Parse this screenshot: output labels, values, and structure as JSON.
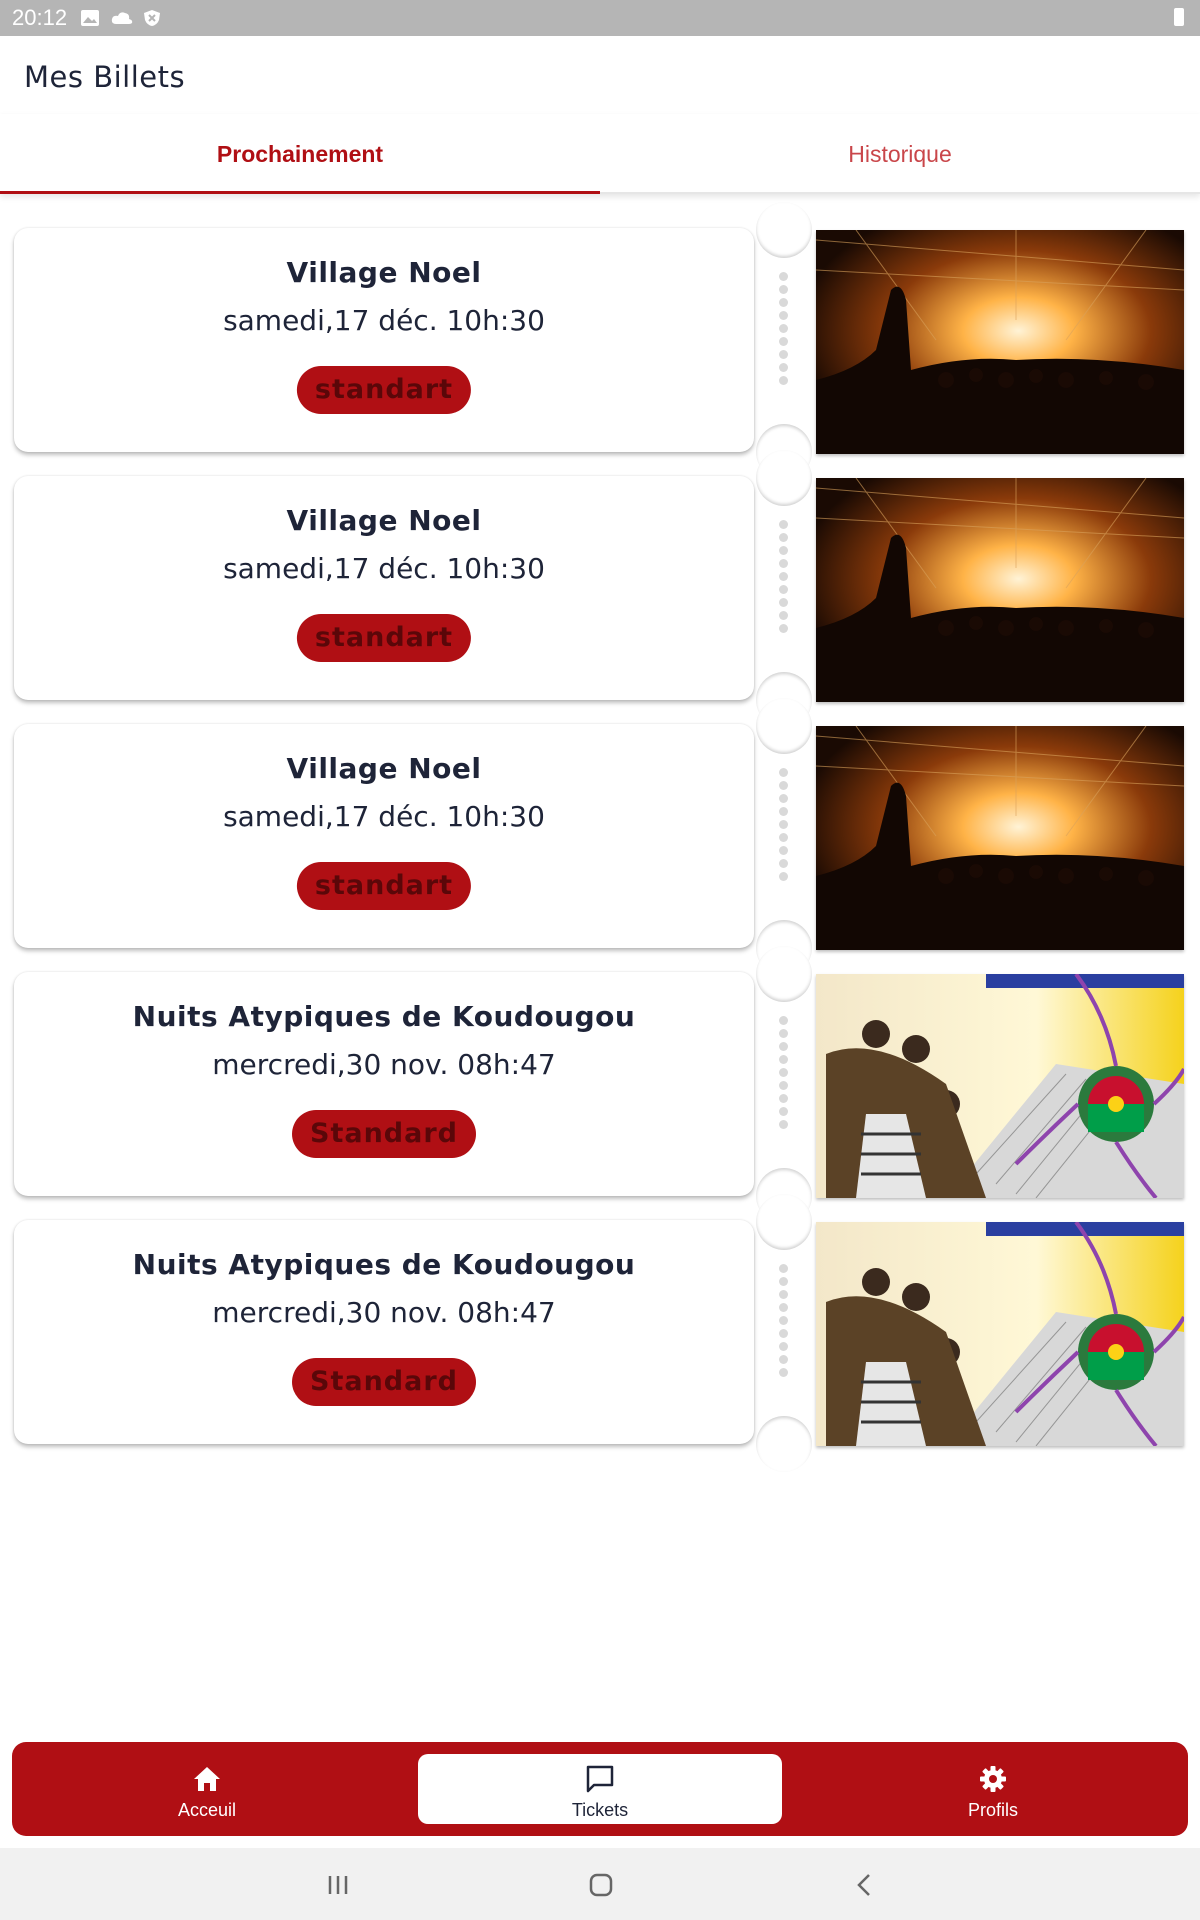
{
  "status_bar": {
    "time": "20:12",
    "icons": [
      "image-icon",
      "cloud-icon",
      "shield-icon",
      "battery-icon"
    ]
  },
  "header": {
    "title": "Mes Billets"
  },
  "tabs": [
    {
      "label": "Prochainement",
      "active": true
    },
    {
      "label": "Historique",
      "active": false
    }
  ],
  "tickets": [
    {
      "title": "Village Noel",
      "date": "samedi,17 déc. 10h:30",
      "type": "standart",
      "image": "concert-crowd-image"
    },
    {
      "title": "Village Noel",
      "date": "samedi,17 déc. 10h:30",
      "type": "standart",
      "image": "concert-crowd-image"
    },
    {
      "title": "Village Noel",
      "date": "samedi,17 déc. 10h:30",
      "type": "standart",
      "image": "concert-crowd-image"
    },
    {
      "title": "Nuits Atypiques de Koudougou",
      "date": "mercredi,30 nov. 08h:47",
      "type": "Standard",
      "image": "festival-poster-image"
    },
    {
      "title": "Nuits Atypiques de Koudougou",
      "date": "mercredi,30 nov. 08h:47",
      "type": "Standard",
      "image": "festival-poster-image"
    }
  ],
  "bottom_nav": {
    "items": [
      {
        "label": "Acceuil",
        "icon": "home-icon",
        "active": false
      },
      {
        "label": "Tickets",
        "icon": "chat-bubble-icon",
        "active": true
      },
      {
        "label": "Profils",
        "icon": "gear-icon",
        "active": false
      }
    ]
  },
  "colors": {
    "accent": "#b00f14",
    "text": "#1e2438",
    "status_bar": "#b5b5b5"
  }
}
